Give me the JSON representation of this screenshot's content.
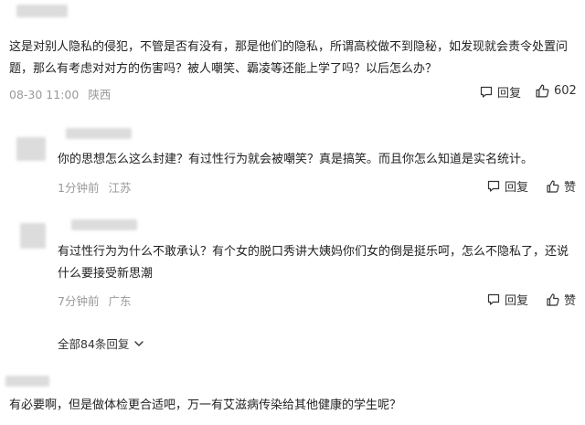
{
  "comment1": {
    "text": "这是对别人隐私的侵犯，不管是否有没有，那是他们的隐私，所谓高校做不到隐秘，如发现就会责令处置问题，那么有考虑对对方的伤害吗？被人嘲笑、霸凌等还能上学了吗？以后怎么办？",
    "time": "08-30 11:00",
    "location": "陕西",
    "reply_label": "回复",
    "like_count": "602"
  },
  "reply1": {
    "text": "你的思想怎么这么封建？有过性行为就会被嘲笑？真是搞笑。而且你怎么知道是实名统计。",
    "time": "1分钟前",
    "location": "江苏",
    "reply_label": "回复",
    "like_label": "赞"
  },
  "reply2": {
    "text": "有过性行为为什么不敢承认？有个女的脱口秀讲大姨妈你们女的倒是挺乐呵，怎么不隐私了，还说什么要接受新思潮",
    "time": "7分钟前",
    "location": "广东",
    "reply_label": "回复",
    "like_label": "赞"
  },
  "replies_toggle": {
    "label": "全部84条回复"
  },
  "comment2": {
    "text": "有必要啊，但是做体检更合适吧，万一有艾滋病传染给其他健康的学生呢？"
  }
}
